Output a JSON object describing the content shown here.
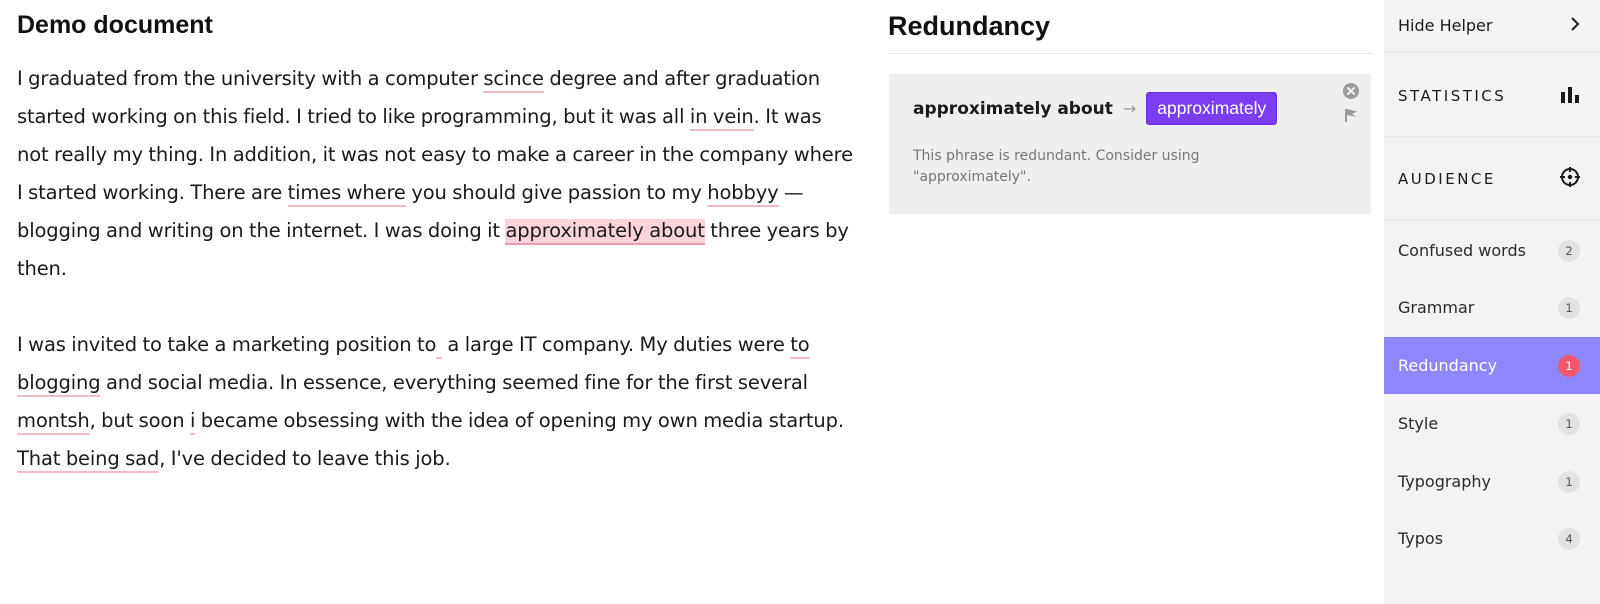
{
  "document": {
    "title": "Demo document",
    "p1": {
      "s1": "I graduated from the university with a computer ",
      "m1": "scince",
      "s2": " degree and after graduation started working on this field. I tried to like programming, but it was all ",
      "m2": "in vein",
      "s3": ". It was not really my thing. In addition, it was not easy to make a career in the company where I started working. There are ",
      "m3": "times where",
      "s4": " you should give passion to my ",
      "m4": "hobbyy",
      "s5": " — blogging and writing on the internet. I was doing it ",
      "m5": "approximately about",
      "s6": " three years by then."
    },
    "p2": {
      "s1": "I was invited to take a marketing position to",
      "m1": " ",
      "s2": " a large IT company. My duties were ",
      "m2": "to blogging",
      "s3": " and social media. In essence, everything seemed fine for the first several ",
      "m3": "montsh",
      "s4": ", but soon ",
      "m4": "i",
      "s5": " became obsessing with the idea of opening my own media startup. ",
      "m5": "That being sad",
      "s6": ", I've decided to leave this job."
    }
  },
  "panel": {
    "title": "Redundancy",
    "card": {
      "phrase": "approximately about",
      "arrow": "→",
      "suggestion": "approximately",
      "description": "This phrase is redundant. Consider using \"approximately\"."
    }
  },
  "sidebar": {
    "hide_helper": "Hide Helper",
    "chevron": "›",
    "statistics": "STATISTICS",
    "audience": "AUDIENCE",
    "categories": [
      {
        "label": "Confused words",
        "count": "2"
      },
      {
        "label": "Grammar",
        "count": "1"
      },
      {
        "label": "Redundancy",
        "count": "1"
      },
      {
        "label": "Style",
        "count": "1"
      },
      {
        "label": "Typography",
        "count": "1"
      },
      {
        "label": "Typos",
        "count": "4"
      }
    ],
    "active_category": "Redundancy",
    "icons": {
      "statistics": "bar-chart-icon",
      "audience": "target-icon",
      "close": "close-icon",
      "flag": "flag-icon"
    }
  },
  "colors": {
    "accent": "#8f86fb",
    "suggestion": "#7b3df2",
    "highlight": "#fbd3db",
    "underline": "#f4b8c6",
    "badge_active": "#f2566a",
    "sidebar_bg": "#f3f3f3",
    "card_bg": "#efefef"
  }
}
